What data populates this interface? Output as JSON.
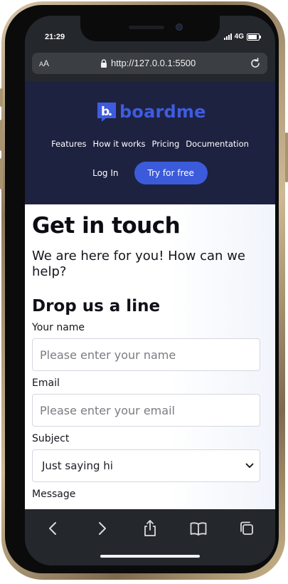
{
  "status_bar": {
    "time": "21:29",
    "network": "4G"
  },
  "browser": {
    "aa_label_big": "A",
    "aa_label_small": "A",
    "url": "http://127.0.0.1:5500"
  },
  "site": {
    "logo_text": "boardme",
    "nav": [
      "Features",
      "How it works",
      "Pricing",
      "Documentation"
    ],
    "login_label": "Log In",
    "cta_label": "Try for free"
  },
  "contact": {
    "title": "Get in touch",
    "intro": "We are here for you! How can we help?",
    "form_title": "Drop us a line",
    "name_label": "Your name",
    "name_placeholder": "Please enter your name",
    "email_label": "Email",
    "email_placeholder": "Please enter your email",
    "subject_label": "Subject",
    "subject_value": "Just saying hi",
    "message_label": "Message"
  },
  "colors": {
    "header_bg": "#1e2241",
    "brand_blue": "#3d5ce0",
    "cta_bg": "#3b5bdb",
    "browser_chrome": "#24272c"
  },
  "toolbar_icons": [
    "back-icon",
    "forward-icon",
    "share-icon",
    "bookmarks-icon",
    "tabs-icon"
  ]
}
